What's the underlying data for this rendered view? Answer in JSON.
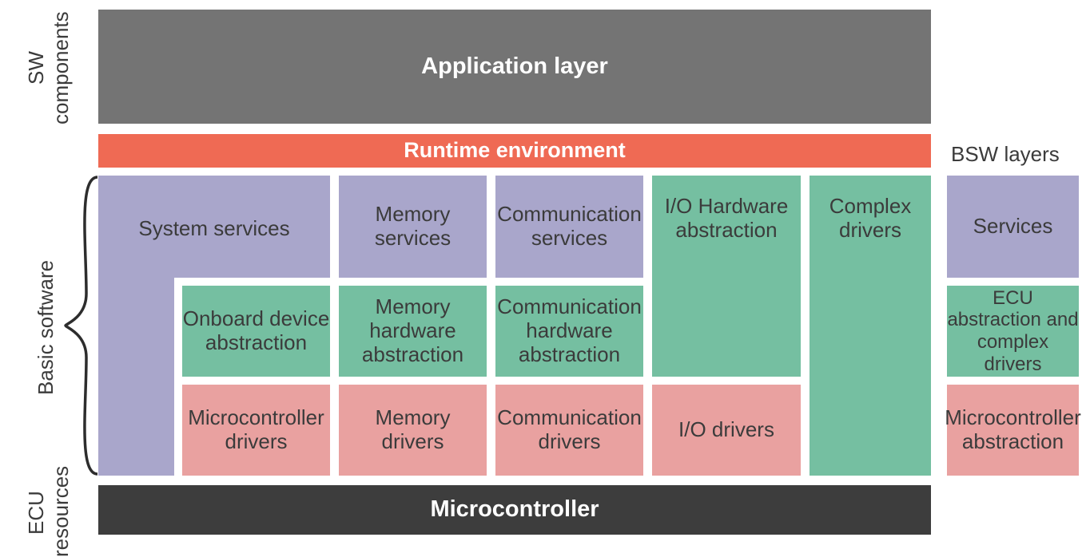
{
  "labels": {
    "sw_components": "SW\ncomponents",
    "basic_software": "Basic software",
    "ecu_resources": "ECU\nresources",
    "bsw_layers": "BSW layers"
  },
  "layers": {
    "application": "Application layer",
    "runtime": "Runtime environment",
    "microcontroller": "Microcontroller"
  },
  "bsw": {
    "system_services": "System services",
    "memory_services": "Memory\nservices",
    "communication_services": "Communication\nservices",
    "io_hw_abstraction": "I/O Hardware\nabstraction",
    "complex_drivers": "Complex\ndrivers",
    "onboard_device_abstraction": "Onboard device\nabstraction",
    "memory_hw_abstraction": "Memory\nhardware\nabstraction",
    "communication_hw_abstraction": "Communication\nhardware\nabstraction",
    "microcontroller_drivers": "Microcontroller\ndrivers",
    "memory_drivers": "Memory\ndrivers",
    "communication_drivers": "Communication\ndrivers",
    "io_drivers": "I/O drivers"
  },
  "legend": {
    "services": "Services",
    "ecu_abstraction": "ECU\nabstraction and\ncomplex drivers",
    "mc_abstraction": "Microcontroller\nabstraction"
  },
  "colors": {
    "gray": "#747474",
    "dark": "#3d3d3d",
    "red": "#ef6a54",
    "lilac": "#a9a6cb",
    "green": "#75bfa1",
    "pink": "#e9a1a0"
  },
  "chart_data": {
    "type": "table",
    "title": "AUTOSAR layered software architecture",
    "row_groups": [
      {
        "label": "SW components",
        "rows": [
          "Application layer"
        ]
      },
      {
        "label": "",
        "rows": [
          "Runtime environment"
        ]
      },
      {
        "label": "Basic software",
        "rows": [
          "Services",
          "ECU abstraction and complex drivers",
          "Microcontroller abstraction"
        ]
      },
      {
        "label": "ECU resources",
        "rows": [
          "Microcontroller"
        ]
      }
    ],
    "columns": [
      "System",
      "Memory",
      "Communication",
      "I/O",
      "Complex drivers"
    ],
    "grid": [
      {
        "row": "Services",
        "col": "System",
        "value": "System services",
        "color": "lilac"
      },
      {
        "row": "Services",
        "col": "Memory",
        "value": "Memory services",
        "color": "lilac"
      },
      {
        "row": "Services",
        "col": "Communication",
        "value": "Communication services",
        "color": "lilac"
      },
      {
        "row": "Services",
        "col": "I/O",
        "value": "I/O Hardware abstraction",
        "color": "green",
        "rowspan": 2
      },
      {
        "row": "Services",
        "col": "Complex drivers",
        "value": "Complex drivers",
        "color": "green",
        "rowspan": 3
      },
      {
        "row": "ECU abstraction and complex drivers",
        "col": "System",
        "value": "Onboard device abstraction",
        "color": "green"
      },
      {
        "row": "ECU abstraction and complex drivers",
        "col": "Memory",
        "value": "Memory hardware abstraction",
        "color": "green"
      },
      {
        "row": "ECU abstraction and complex drivers",
        "col": "Communication",
        "value": "Communication hardware abstraction",
        "color": "green"
      },
      {
        "row": "Microcontroller abstraction",
        "col": "System",
        "value": "Microcontroller drivers",
        "color": "pink"
      },
      {
        "row": "Microcontroller abstraction",
        "col": "Memory",
        "value": "Memory drivers",
        "color": "pink"
      },
      {
        "row": "Microcontroller abstraction",
        "col": "Communication",
        "value": "Communication drivers",
        "color": "pink"
      },
      {
        "row": "Microcontroller abstraction",
        "col": "I/O",
        "value": "I/O drivers",
        "color": "pink"
      }
    ],
    "legend": [
      {
        "label": "Services",
        "color": "lilac"
      },
      {
        "label": "ECU abstraction and complex drivers",
        "color": "green"
      },
      {
        "label": "Microcontroller abstraction",
        "color": "pink"
      }
    ]
  }
}
